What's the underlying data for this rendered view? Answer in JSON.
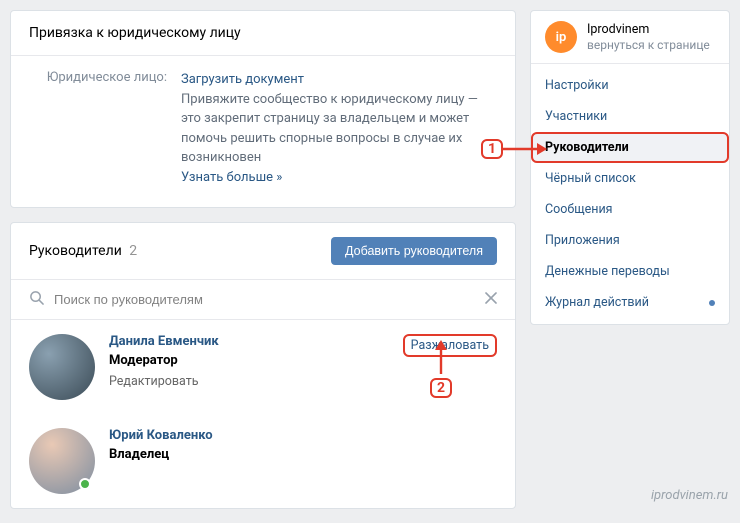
{
  "legal_card": {
    "title": "Привязка к юридическому лицу",
    "label": "Юридическое лицо:",
    "upload_link": "Загрузить документ",
    "desc": "Привяжите сообщество к юридическому лицу — это закрепит страницу за владельцем и может помочь решить спорные вопросы в случае их возникновен",
    "more": "Узнать больше »"
  },
  "managers_card": {
    "title": "Руководители",
    "count": "2",
    "add_button": "Добавить руководителя",
    "search_placeholder": "Поиск по руководителям"
  },
  "members": [
    {
      "name": "Данила Евменчик",
      "role": "Модератор",
      "edit": "Редактировать",
      "action": "Разжаловать"
    },
    {
      "name": "Юрий Коваленко",
      "role": "Владелец"
    }
  ],
  "sidebar": {
    "avatar_text": "ip",
    "profile_name": "Iprodvinem",
    "back_text": "вернуться к странице",
    "items": [
      {
        "label": "Настройки"
      },
      {
        "label": "Участники"
      },
      {
        "label": "Руководители"
      },
      {
        "label": "Чёрный список"
      },
      {
        "label": "Сообщения"
      },
      {
        "label": "Приложения"
      },
      {
        "label": "Денежные переводы"
      },
      {
        "label": "Журнал действий"
      }
    ]
  },
  "annotations": {
    "one": "1",
    "two": "2"
  },
  "watermark": "iprodvinem.ru"
}
